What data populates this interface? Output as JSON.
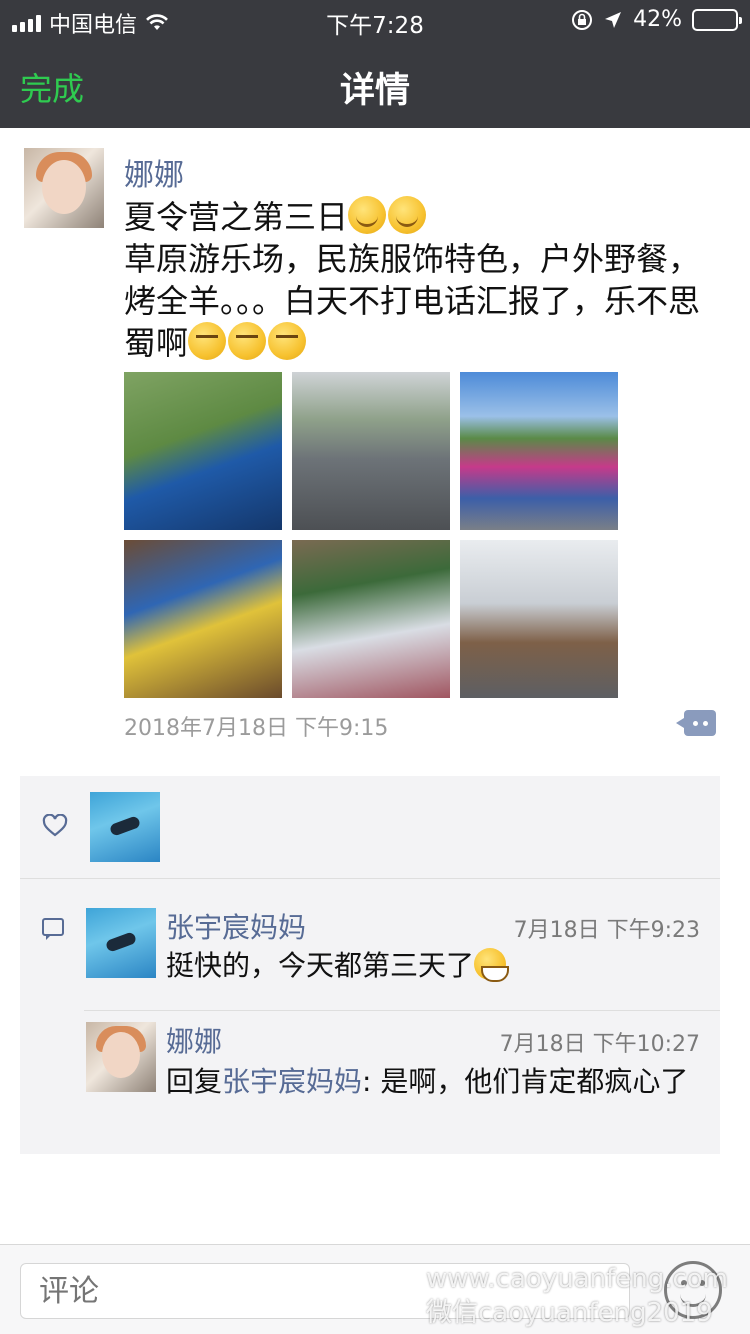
{
  "status_bar": {
    "carrier": "中国电信",
    "time": "下午7:28",
    "battery": "42%",
    "battery_level": 0.42
  },
  "nav": {
    "done": "完成",
    "title": "详情"
  },
  "post": {
    "author": "娜娜",
    "title_line": "夏令营之第三日",
    "body": "草原游乐场，民族服饰特色，户外野餐，烤全羊。。。白天不打电话汇报了，乐不思蜀啊",
    "timestamp": "2018年7月18日 下午9:15",
    "photo_count": 6
  },
  "comments": [
    {
      "name": "张宇宸妈妈",
      "time": "7月18日 下午9:23",
      "text": "挺快的，今天都第三天了"
    },
    {
      "name": "娜娜",
      "time": "7月18日 下午10:27",
      "reply_prefix": "回复",
      "reply_to": "张宇宸妈妈",
      "reply_sep": ": ",
      "text": "是啊，他们肯定都疯心了"
    }
  ],
  "input": {
    "placeholder": "评论"
  },
  "watermark": {
    "line1": "www.caoyuanfeng.com",
    "line2": "微信caoyuanfeng2019"
  },
  "colors": {
    "nav_bg": "#393a3f",
    "accent_green": "#2fcb50",
    "link_blue": "#576b95"
  }
}
